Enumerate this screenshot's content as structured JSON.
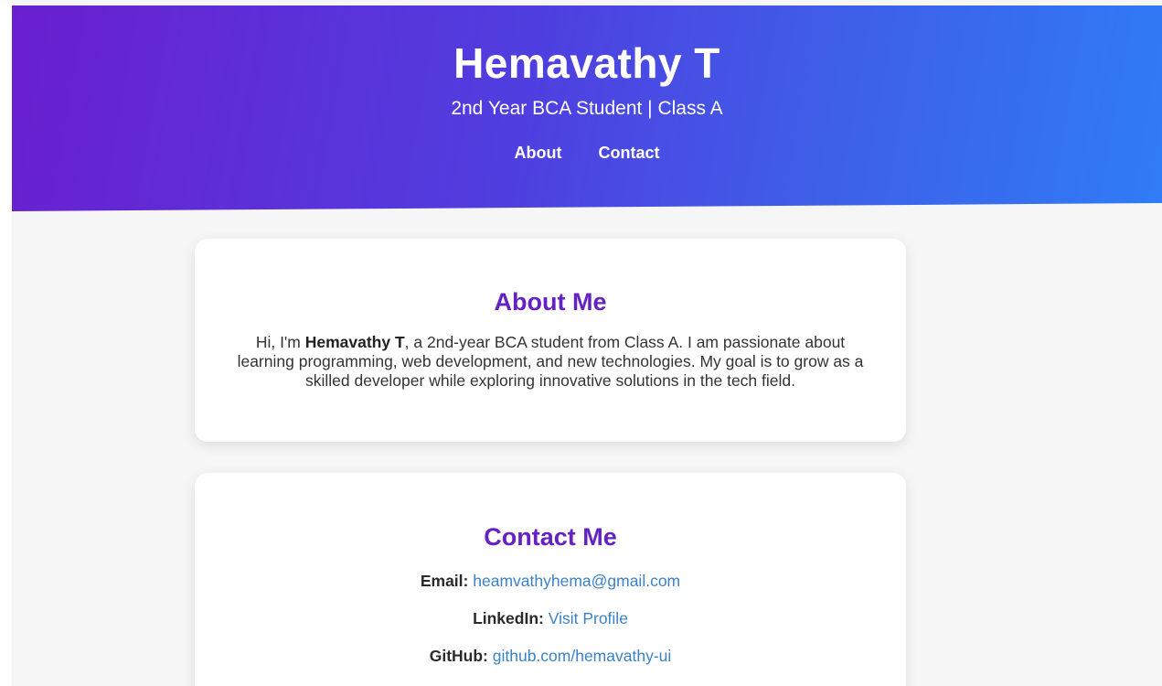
{
  "header": {
    "name": "Hemavathy T",
    "subtitle": "2nd Year BCA Student | Class A",
    "nav": [
      {
        "label": "About"
      },
      {
        "label": "Contact"
      }
    ]
  },
  "about": {
    "heading": "About Me",
    "text_prefix": "Hi, I'm ",
    "text_name": "Hemavathy T",
    "text_suffix": ", a 2nd-year BCA student from Class A. I am passionate about learning programming, web development, and new technologies. My goal is to grow as a skilled developer while exploring innovative solutions in the tech field."
  },
  "contact": {
    "heading": "Contact Me",
    "email_label": "Email:",
    "email_value": "heamvathyhema@gmail.com",
    "linkedin_label": "LinkedIn:",
    "linkedin_value": "Visit Profile",
    "github_label": "GitHub:",
    "github_value": "github.com/hemavathy-ui"
  },
  "colors": {
    "heading": "#6521c1",
    "link": "#3b82c8",
    "gradient_start": "#6a1fcf",
    "gradient_end": "#2f7cf6"
  }
}
